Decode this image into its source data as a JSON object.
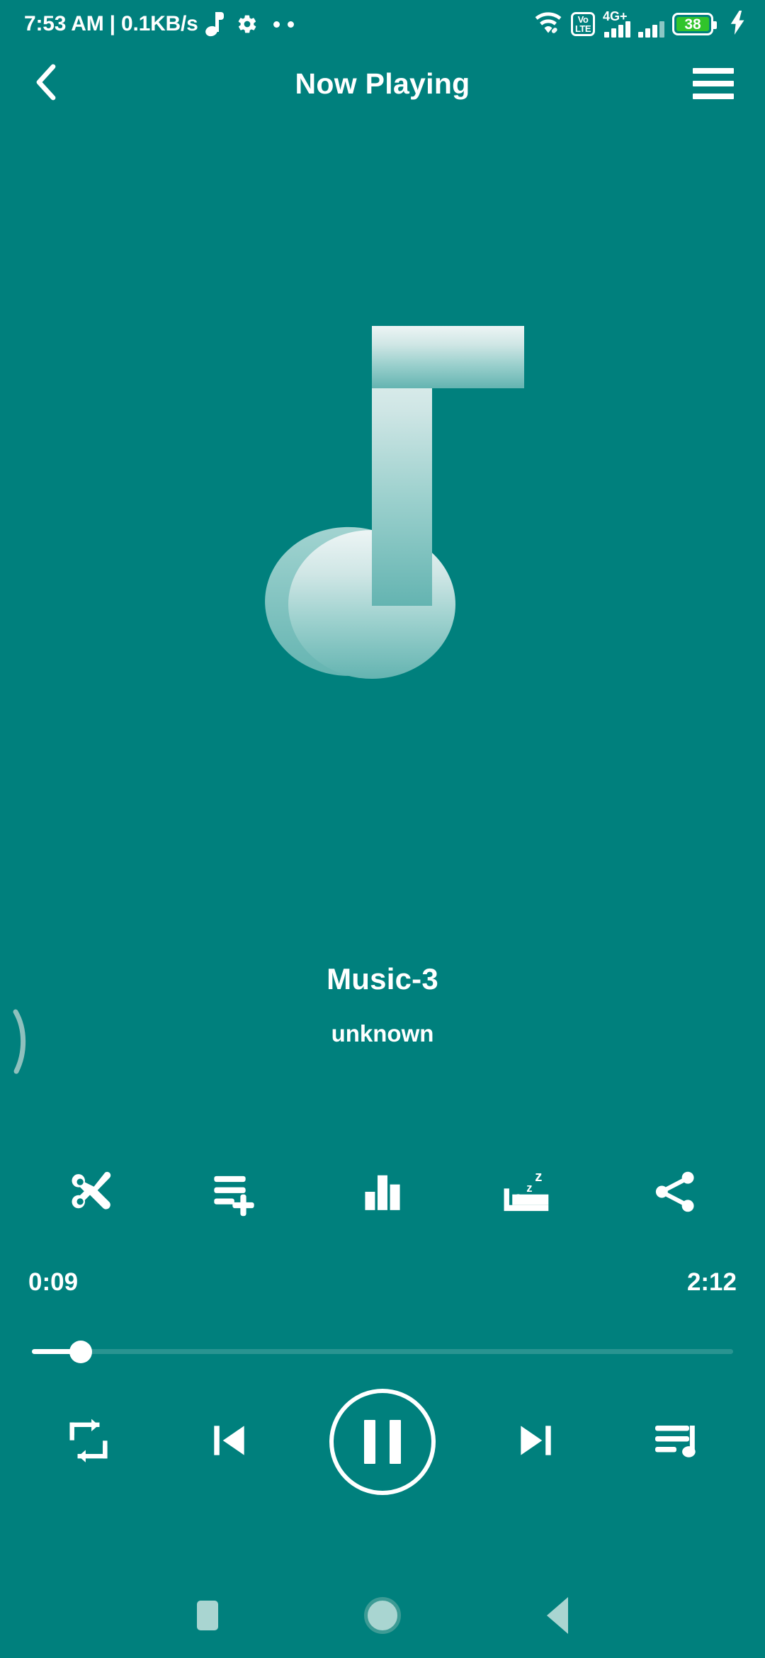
{
  "theme": {
    "background": "#00807d",
    "foreground": "#ffffff",
    "battery_fill": "#31c42b",
    "navbar_icon": "#a9d5d1",
    "track_inactive": "rgba(255,255,255,0.16)"
  },
  "status_bar": {
    "clock_and_rate": "7:53 AM | 0.1KB/s",
    "music_note_icon": "music-note-icon",
    "gear_icon": "gear-icon",
    "more_dots_icon": "two-dots-icon",
    "wifi_icon": "wifi-icon",
    "volte_line1": "Vo",
    "volte_line2": "LTE",
    "network_label": "4G+",
    "signal_icon": "signal-bars-icon",
    "signal_icon_2": "signal-bars-icon-2",
    "battery_level": "38",
    "charging_icon": "charging-bolt-icon"
  },
  "app_bar": {
    "back_icon": "chevron-left-icon",
    "title": "Now Playing",
    "menu_icon": "hamburger-menu-icon"
  },
  "album_art": {
    "icon": "music-note-artwork-icon",
    "gradient_top": "#eef6f6",
    "gradient_bottom": "#63b5b2"
  },
  "track": {
    "title": "Music-3",
    "artist": "unknown"
  },
  "actions": [
    {
      "name": "cut-ringtone-button",
      "icon": "scissors-icon"
    },
    {
      "name": "add-to-playlist-button",
      "icon": "playlist-add-icon"
    },
    {
      "name": "equalizer-button",
      "icon": "equalizer-icon"
    },
    {
      "name": "sleep-timer-button",
      "icon": "sleep-timer-bed-icon"
    },
    {
      "name": "share-button",
      "icon": "share-icon"
    }
  ],
  "seek": {
    "elapsed": "0:09",
    "duration": "2:12",
    "progress_percent": 7
  },
  "controls": [
    {
      "name": "repeat-button",
      "icon": "repeat-icon"
    },
    {
      "name": "previous-button",
      "icon": "skip-previous-icon"
    },
    {
      "name": "play-pause-button",
      "icon": "pause-icon"
    },
    {
      "name": "next-button",
      "icon": "skip-next-icon"
    },
    {
      "name": "queue-button",
      "icon": "playlist-queue-music-icon"
    }
  ],
  "nav_bar": {
    "recents_icon": "recents-square-icon",
    "home_icon": "home-circle-icon",
    "back_icon": "back-triangle-icon"
  }
}
